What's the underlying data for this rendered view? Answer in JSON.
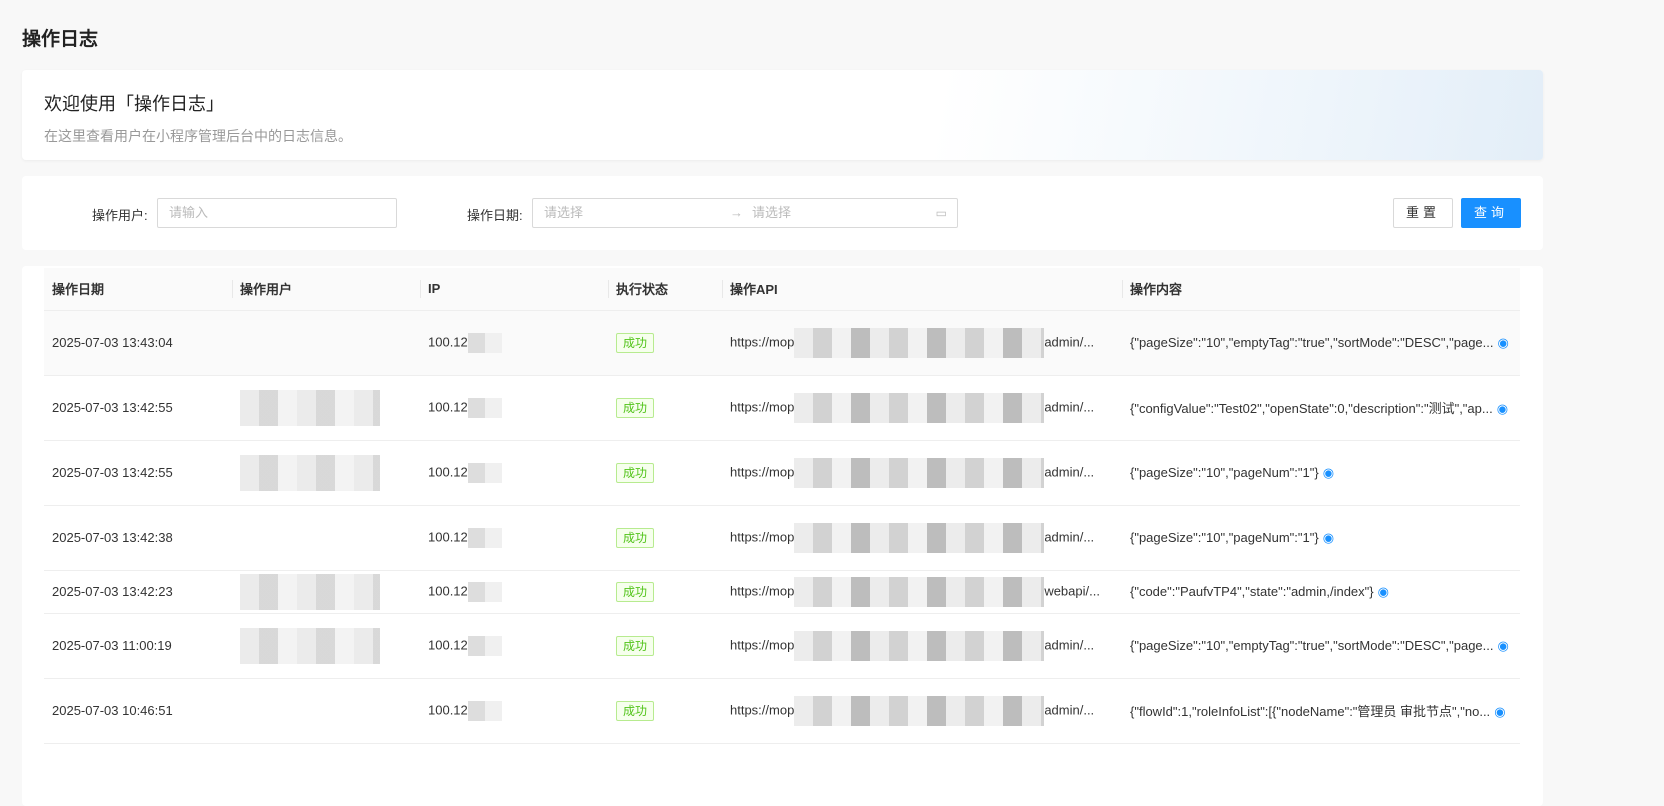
{
  "page_title": "操作日志",
  "welcome": {
    "title": "欢迎使用「操作日志」",
    "desc": "在这里查看用户在小程序管理后台中的日志信息。"
  },
  "filter": {
    "user_label": "操作用户:",
    "user_placeholder": "请输入",
    "date_label": "操作日期:",
    "start_placeholder": "请选择",
    "end_placeholder": "请选择",
    "arrow": "→",
    "reset": "重置",
    "search": "查询"
  },
  "table": {
    "columns": [
      "操作日期",
      "操作用户",
      "IP",
      "执行状态",
      "操作API",
      "操作内容"
    ],
    "rows": [
      {
        "date": "2025-07-03 13:43:04",
        "ip": "100.12",
        "status": "成功",
        "api_prefix": "https://mop",
        "api_suffix": "admin/...",
        "content": "{\"pageSize\":\"10\",\"emptyTag\":\"true\",\"sortMode\":\"DESC\",\"page..."
      },
      {
        "date": "2025-07-03 13:42:55",
        "ip": "100.12",
        "status": "成功",
        "api_prefix": "https://mop",
        "api_suffix": "admin/...",
        "content": "{\"configValue\":\"Test02\",\"openState\":0,\"description\":\"测试\",\"ap..."
      },
      {
        "date": "2025-07-03 13:42:55",
        "ip": "100.12",
        "status": "成功",
        "api_prefix": "https://mop",
        "api_suffix": "admin/...",
        "content": "{\"pageSize\":\"10\",\"pageNum\":\"1\"}"
      },
      {
        "date": "2025-07-03 13:42:38",
        "ip": "100.12",
        "status": "成功",
        "api_prefix": "https://mop",
        "api_suffix": "admin/...",
        "content": "{\"pageSize\":\"10\",\"pageNum\":\"1\"}"
      },
      {
        "date": "2025-07-03 13:42:23",
        "ip": "100.12",
        "status": "成功",
        "api_prefix": "https://mop",
        "api_suffix": "webapi/...",
        "content": "{\"code\":\"PaufvTP4\",\"state\":\"admin,/index\"}"
      },
      {
        "date": "2025-07-03 11:00:19",
        "ip": "100.12",
        "status": "成功",
        "api_prefix": "https://mop",
        "api_suffix": "admin/...",
        "content": "{\"pageSize\":\"10\",\"emptyTag\":\"true\",\"sortMode\":\"DESC\",\"page..."
      },
      {
        "date": "2025-07-03 10:46:51",
        "ip": "100.12",
        "status": "成功",
        "api_prefix": "https://mop",
        "api_suffix": "admin/...",
        "content": "{\"flowId\":1,\"roleInfoList\":[{\"nodeName\":\"管理员 审批节点\",\"no..."
      }
    ]
  },
  "colors": {
    "primary": "#1890ff",
    "success": "#52c41a"
  }
}
